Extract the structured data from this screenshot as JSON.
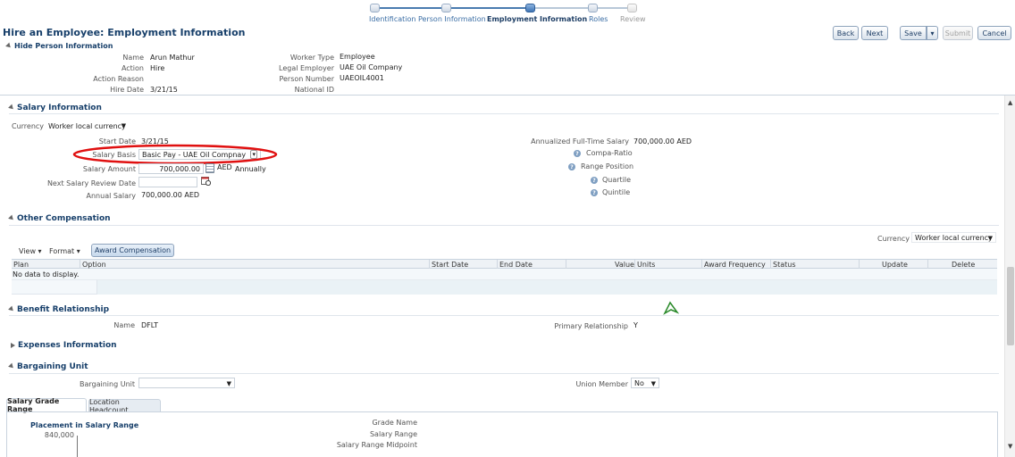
{
  "train": {
    "steps": [
      {
        "label": "Identification",
        "state": "done"
      },
      {
        "label": "Person Information",
        "state": "done"
      },
      {
        "label": "Employment Information",
        "state": "current"
      },
      {
        "label": "Roles",
        "state": "next"
      },
      {
        "label": "Review",
        "state": "future"
      }
    ]
  },
  "page_title": "Hire an Employee: Employment Information",
  "toolbar": {
    "back": "Back",
    "next": "Next",
    "save": "Save",
    "submit": "Submit",
    "cancel": "Cancel"
  },
  "person": {
    "toggle": "Hide Person Information",
    "name_label": "Name",
    "name": "Arun Mathur",
    "action_label": "Action",
    "action": "Hire",
    "action_reason_label": "Action Reason",
    "action_reason": "",
    "hire_date_label": "Hire Date",
    "hire_date": "3/21/15",
    "worker_type_label": "Worker Type",
    "worker_type": "Employee",
    "legal_employer_label": "Legal Employer",
    "legal_employer": "UAE Oil Company",
    "person_number_label": "Person Number",
    "person_number": "UAEOIL4001",
    "national_id_label": "National ID",
    "national_id": ""
  },
  "salary": {
    "title": "Salary Information",
    "currency_label": "Currency",
    "currency": "Worker local currency",
    "start_date_label": "Start Date",
    "start_date": "3/21/15",
    "basis_label": "Salary Basis",
    "basis": "Basic Pay - UAE Oil Compnay",
    "amount_label": "Salary Amount",
    "amount": "700,000.00",
    "amount_currency": "AED",
    "amount_freq": "Annually",
    "review_label": "Next Salary Review Date",
    "review": "",
    "annual_label": "Annual Salary",
    "annual": "700,000.00 AED",
    "annualized_label": "Annualized Full-Time Salary",
    "annualized": "700,000.00 AED",
    "compa_ratio": "Compa-Ratio",
    "range_position": "Range Position",
    "quartile": "Quartile",
    "quintile": "Quintile"
  },
  "other_comp": {
    "title": "Other Compensation",
    "currency_label": "Currency",
    "currency": "Worker local currency",
    "view": "View",
    "format": "Format",
    "award_button": "Award Compensation",
    "columns": [
      "Plan",
      "Option",
      "Start Date",
      "End Date",
      "Value",
      "Units",
      "Award Frequency",
      "Status",
      "Update",
      "Delete"
    ],
    "empty": "No data to display."
  },
  "benefit": {
    "title": "Benefit Relationship",
    "name_label": "Name",
    "name": "DFLT",
    "primary_label": "Primary Relationship",
    "primary": "Y"
  },
  "expenses": {
    "title": "Expenses Information"
  },
  "bargaining": {
    "title": "Bargaining Unit",
    "unit_label": "Bargaining Unit",
    "unit": "",
    "union_label": "Union Member",
    "union": "No"
  },
  "tabs": {
    "salary_grade": "Salary Grade Range",
    "location_headcount": "Location Headcount"
  },
  "placement": {
    "title": "Placement in Salary Range",
    "axis_top": "840,000",
    "grade_name_label": "Grade Name",
    "salary_range_label": "Salary Range",
    "midpoint_label": "Salary Range Midpoint"
  }
}
